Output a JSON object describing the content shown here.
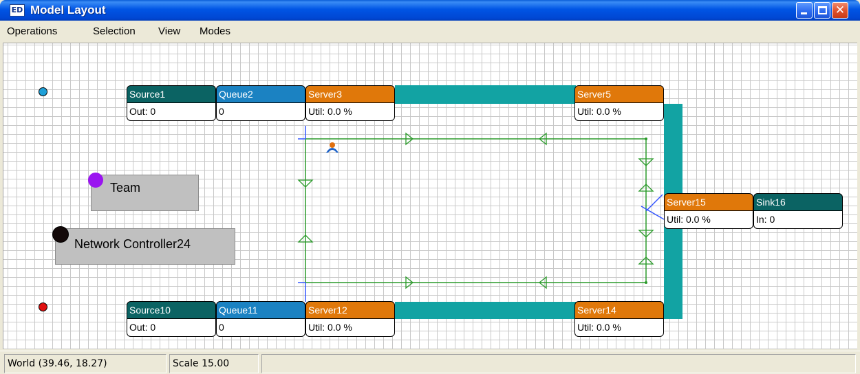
{
  "window": {
    "title": "Model Layout",
    "app_icon_text": "ED",
    "buttons": [
      "minimize",
      "maximize",
      "close"
    ]
  },
  "menu": {
    "items": [
      "Operations",
      "Selection",
      "View",
      "Modes"
    ]
  },
  "colors": {
    "source": "#0b6363",
    "queue": "#1b82c2",
    "server": "#e0780a",
    "sink": "#0b6363",
    "conveyor": "#12a3a3",
    "path": "#2a9a2a",
    "node": "#3355ff"
  },
  "objects": {
    "source1": {
      "name": "Source1",
      "value": "Out: 0"
    },
    "queue2": {
      "name": "Queue2",
      "value": "0"
    },
    "server3": {
      "name": "Server3",
      "value": "Util: 0.0 %"
    },
    "server5": {
      "name": "Server5",
      "value": "Util: 0.0 %"
    },
    "server15": {
      "name": "Server15",
      "value": "Util: 0.0 %"
    },
    "sink16": {
      "name": "Sink16",
      "value": "In: 0"
    },
    "source10": {
      "name": "Source10",
      "value": "Out: 0"
    },
    "queue11": {
      "name": "Queue11",
      "value": "0"
    },
    "server12": {
      "name": "Server12",
      "value": "Util: 0.0 %"
    },
    "server14": {
      "name": "Server14",
      "value": "Util: 0.0 %"
    }
  },
  "labels": {
    "team": "Team",
    "network_controller": "Network Controller24"
  },
  "status": {
    "world": "World (39.46, 18.27)",
    "scale": "Scale 15.00",
    "message": ""
  }
}
